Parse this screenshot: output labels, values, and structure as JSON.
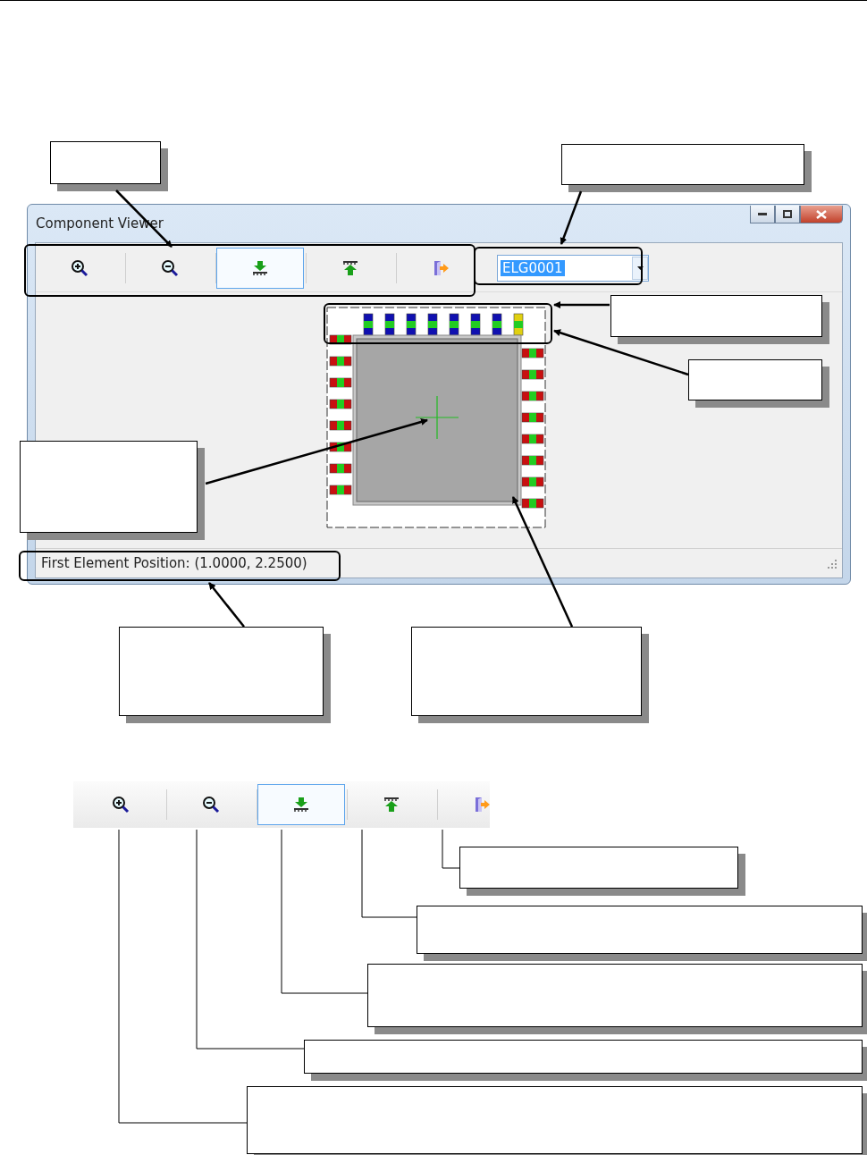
{
  "window": {
    "title": "Component Viewer"
  },
  "toolbar": [
    {
      "kind": "zoom-in",
      "selected": false
    },
    {
      "kind": "zoom-out",
      "selected": false
    },
    {
      "kind": "down",
      "selected": true
    },
    {
      "kind": "up",
      "selected": false
    },
    {
      "kind": "exit",
      "selected": false
    }
  ],
  "combo": {
    "value": "ELG0001"
  },
  "status_bar": "First Element Position: (1.0000, 2.2500)",
  "legend_toolbar": [
    {
      "kind": "zoom-in",
      "selected": false
    },
    {
      "kind": "zoom-out",
      "selected": false
    },
    {
      "kind": "down",
      "selected": true
    },
    {
      "kind": "up",
      "selected": false
    },
    {
      "kind": "exit",
      "selected": false
    }
  ]
}
